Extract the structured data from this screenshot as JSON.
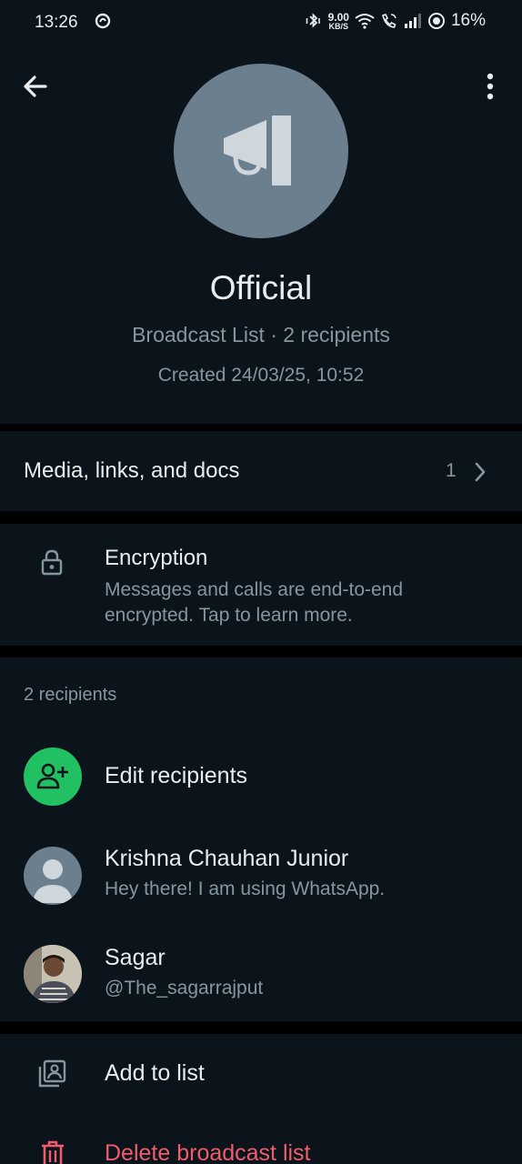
{
  "status_bar": {
    "time": "13:26",
    "speed_value": "9.00",
    "speed_unit": "KB/S",
    "battery": "16%"
  },
  "header": {
    "back_icon": "arrow-left-icon",
    "more_icon": "more-vertical-icon",
    "avatar_icon": "megaphone-icon",
    "title": "Official",
    "subtitle": "Broadcast List · 2 recipients",
    "created": "Created 24/03/25, 10:52"
  },
  "media": {
    "label": "Media, links, and docs",
    "count": "1"
  },
  "encryption": {
    "title": "Encryption",
    "description": "Messages and calls are end-to-end encrypted. Tap to learn more."
  },
  "recipients": {
    "header": "2 recipients",
    "edit_label": "Edit recipients",
    "contacts": [
      {
        "name": "Krishna Chauhan Junior",
        "status": "Hey there! I am using WhatsApp."
      },
      {
        "name": "Sagar",
        "status": "@The_sagarrajput"
      }
    ]
  },
  "actions": {
    "add_to_list": "Add to list",
    "delete": "Delete broadcast list"
  },
  "colors": {
    "background": "#0b141a",
    "accent_green": "#21c063",
    "danger": "#f15c6d",
    "secondary_text": "#8696a0"
  }
}
